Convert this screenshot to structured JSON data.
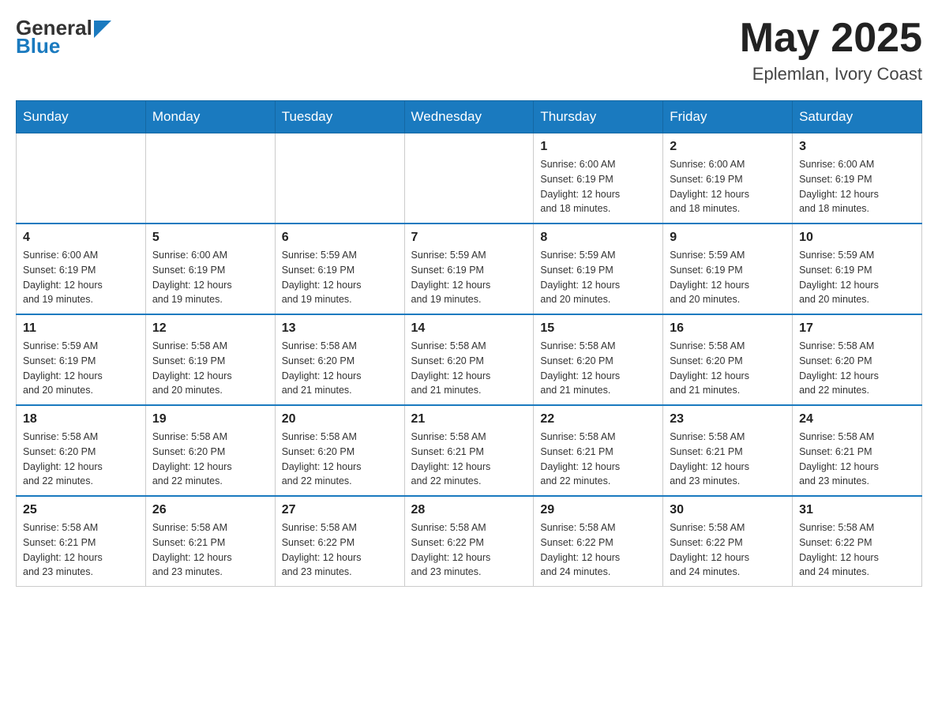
{
  "logo": {
    "text_general": "General",
    "text_blue": "Blue"
  },
  "header": {
    "month": "May 2025",
    "location": "Eplemlan, Ivory Coast"
  },
  "days_of_week": [
    "Sunday",
    "Monday",
    "Tuesday",
    "Wednesday",
    "Thursday",
    "Friday",
    "Saturday"
  ],
  "weeks": [
    [
      {
        "day": "",
        "info": ""
      },
      {
        "day": "",
        "info": ""
      },
      {
        "day": "",
        "info": ""
      },
      {
        "day": "",
        "info": ""
      },
      {
        "day": "1",
        "info": "Sunrise: 6:00 AM\nSunset: 6:19 PM\nDaylight: 12 hours\nand 18 minutes."
      },
      {
        "day": "2",
        "info": "Sunrise: 6:00 AM\nSunset: 6:19 PM\nDaylight: 12 hours\nand 18 minutes."
      },
      {
        "day": "3",
        "info": "Sunrise: 6:00 AM\nSunset: 6:19 PM\nDaylight: 12 hours\nand 18 minutes."
      }
    ],
    [
      {
        "day": "4",
        "info": "Sunrise: 6:00 AM\nSunset: 6:19 PM\nDaylight: 12 hours\nand 19 minutes."
      },
      {
        "day": "5",
        "info": "Sunrise: 6:00 AM\nSunset: 6:19 PM\nDaylight: 12 hours\nand 19 minutes."
      },
      {
        "day": "6",
        "info": "Sunrise: 5:59 AM\nSunset: 6:19 PM\nDaylight: 12 hours\nand 19 minutes."
      },
      {
        "day": "7",
        "info": "Sunrise: 5:59 AM\nSunset: 6:19 PM\nDaylight: 12 hours\nand 19 minutes."
      },
      {
        "day": "8",
        "info": "Sunrise: 5:59 AM\nSunset: 6:19 PM\nDaylight: 12 hours\nand 20 minutes."
      },
      {
        "day": "9",
        "info": "Sunrise: 5:59 AM\nSunset: 6:19 PM\nDaylight: 12 hours\nand 20 minutes."
      },
      {
        "day": "10",
        "info": "Sunrise: 5:59 AM\nSunset: 6:19 PM\nDaylight: 12 hours\nand 20 minutes."
      }
    ],
    [
      {
        "day": "11",
        "info": "Sunrise: 5:59 AM\nSunset: 6:19 PM\nDaylight: 12 hours\nand 20 minutes."
      },
      {
        "day": "12",
        "info": "Sunrise: 5:58 AM\nSunset: 6:19 PM\nDaylight: 12 hours\nand 20 minutes."
      },
      {
        "day": "13",
        "info": "Sunrise: 5:58 AM\nSunset: 6:20 PM\nDaylight: 12 hours\nand 21 minutes."
      },
      {
        "day": "14",
        "info": "Sunrise: 5:58 AM\nSunset: 6:20 PM\nDaylight: 12 hours\nand 21 minutes."
      },
      {
        "day": "15",
        "info": "Sunrise: 5:58 AM\nSunset: 6:20 PM\nDaylight: 12 hours\nand 21 minutes."
      },
      {
        "day": "16",
        "info": "Sunrise: 5:58 AM\nSunset: 6:20 PM\nDaylight: 12 hours\nand 21 minutes."
      },
      {
        "day": "17",
        "info": "Sunrise: 5:58 AM\nSunset: 6:20 PM\nDaylight: 12 hours\nand 22 minutes."
      }
    ],
    [
      {
        "day": "18",
        "info": "Sunrise: 5:58 AM\nSunset: 6:20 PM\nDaylight: 12 hours\nand 22 minutes."
      },
      {
        "day": "19",
        "info": "Sunrise: 5:58 AM\nSunset: 6:20 PM\nDaylight: 12 hours\nand 22 minutes."
      },
      {
        "day": "20",
        "info": "Sunrise: 5:58 AM\nSunset: 6:20 PM\nDaylight: 12 hours\nand 22 minutes."
      },
      {
        "day": "21",
        "info": "Sunrise: 5:58 AM\nSunset: 6:21 PM\nDaylight: 12 hours\nand 22 minutes."
      },
      {
        "day": "22",
        "info": "Sunrise: 5:58 AM\nSunset: 6:21 PM\nDaylight: 12 hours\nand 22 minutes."
      },
      {
        "day": "23",
        "info": "Sunrise: 5:58 AM\nSunset: 6:21 PM\nDaylight: 12 hours\nand 23 minutes."
      },
      {
        "day": "24",
        "info": "Sunrise: 5:58 AM\nSunset: 6:21 PM\nDaylight: 12 hours\nand 23 minutes."
      }
    ],
    [
      {
        "day": "25",
        "info": "Sunrise: 5:58 AM\nSunset: 6:21 PM\nDaylight: 12 hours\nand 23 minutes."
      },
      {
        "day": "26",
        "info": "Sunrise: 5:58 AM\nSunset: 6:21 PM\nDaylight: 12 hours\nand 23 minutes."
      },
      {
        "day": "27",
        "info": "Sunrise: 5:58 AM\nSunset: 6:22 PM\nDaylight: 12 hours\nand 23 minutes."
      },
      {
        "day": "28",
        "info": "Sunrise: 5:58 AM\nSunset: 6:22 PM\nDaylight: 12 hours\nand 23 minutes."
      },
      {
        "day": "29",
        "info": "Sunrise: 5:58 AM\nSunset: 6:22 PM\nDaylight: 12 hours\nand 24 minutes."
      },
      {
        "day": "30",
        "info": "Sunrise: 5:58 AM\nSunset: 6:22 PM\nDaylight: 12 hours\nand 24 minutes."
      },
      {
        "day": "31",
        "info": "Sunrise: 5:58 AM\nSunset: 6:22 PM\nDaylight: 12 hours\nand 24 minutes."
      }
    ]
  ]
}
